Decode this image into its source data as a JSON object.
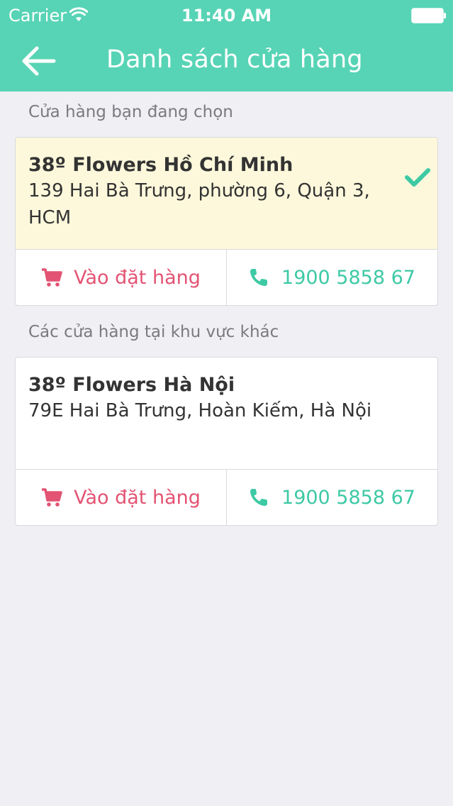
{
  "status_bar": {
    "carrier": "Carrier",
    "time": "11:40 AM",
    "wifi_icon": "wifi-icon",
    "battery_icon": "battery-icon"
  },
  "nav": {
    "title": "Danh sách cửa hàng",
    "back_icon": "arrow-left-icon",
    "background_color": "#57d4b5"
  },
  "current_section": {
    "title": "Cửa hàng bạn đang chọn",
    "store": {
      "name": "38º Flowers Hồ Chí Minh",
      "address": "139 Hai Bà Trưng, phường 6, Quận 3, HCM",
      "selected": true,
      "selected_icon": "checkmark-icon",
      "order_label": "Vào đặt hàng",
      "order_icon": "cart-icon",
      "phone": "1900 5858 67",
      "phone_icon": "phone-icon"
    }
  },
  "other_section": {
    "title": "Các cửa hàng tại khu vực khác",
    "stores": [
      {
        "name": "38º Flowers Hà Nội",
        "address": "79E Hai Bà Trưng, Hoàn Kiếm, Hà Nội",
        "order_label": "Vào đặt hàng",
        "order_icon": "cart-icon",
        "phone": "1900 5858 67",
        "phone_icon": "phone-icon"
      }
    ]
  },
  "colors": {
    "accent": "#57d4b5",
    "order": "#e35373",
    "phone": "#3ec9a5",
    "selected_background": "#fdf8db"
  }
}
